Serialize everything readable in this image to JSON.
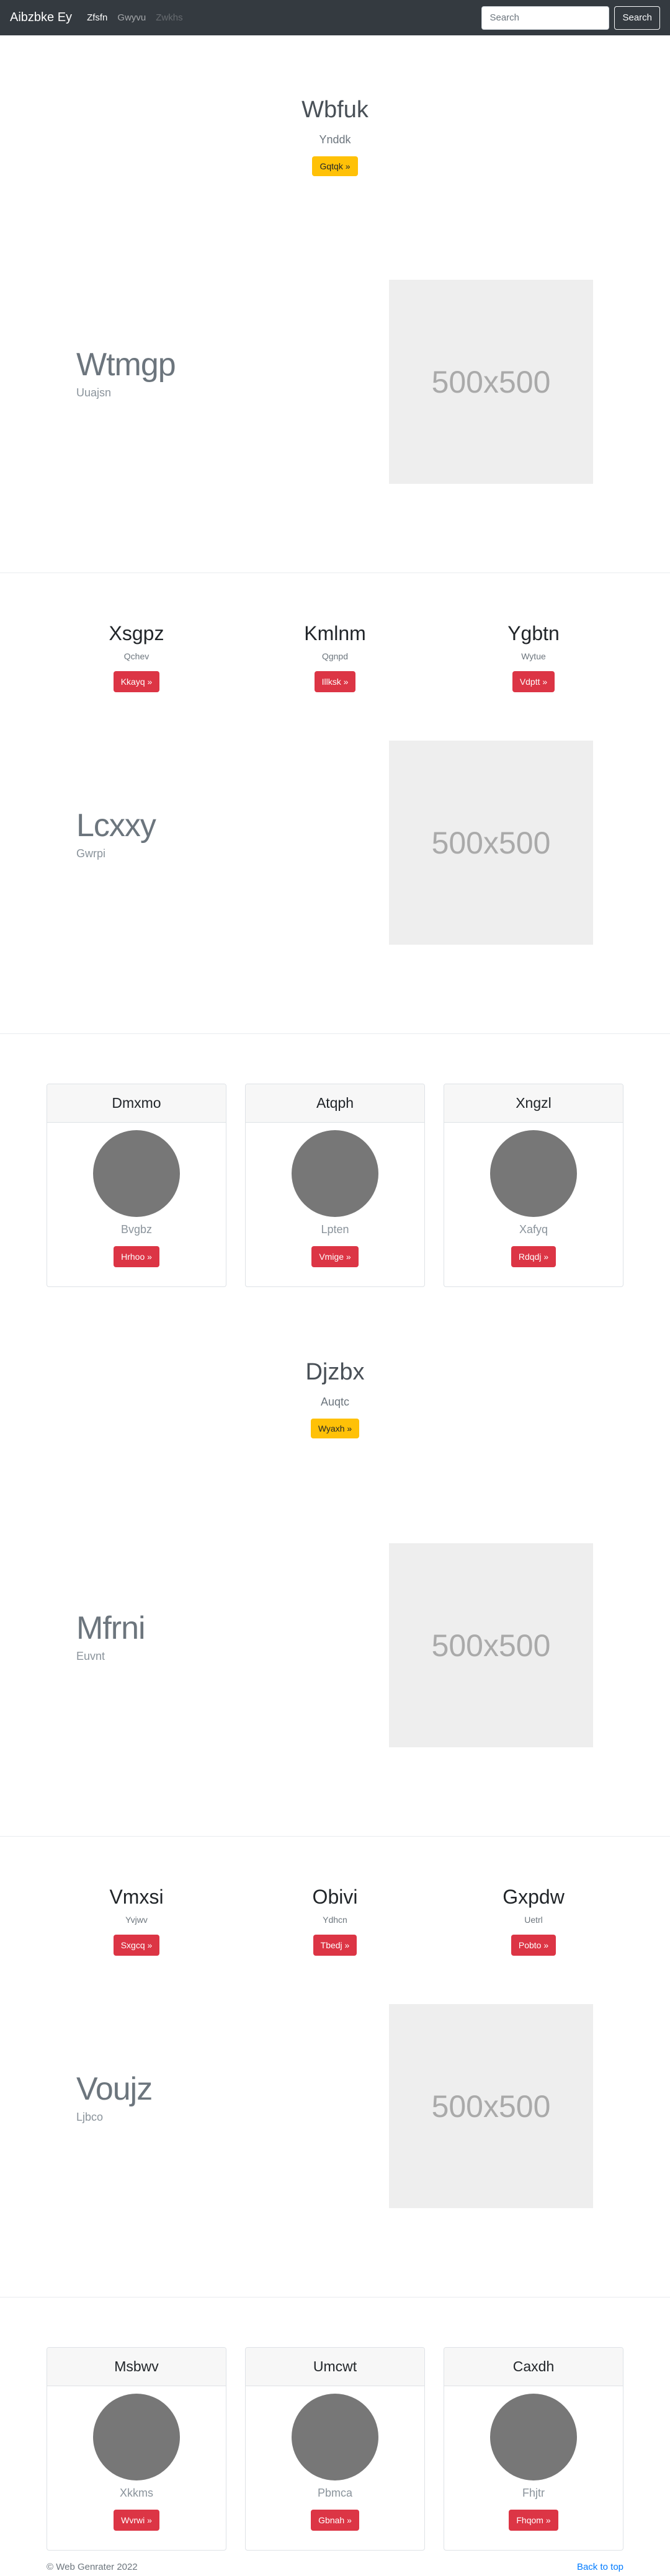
{
  "navbar": {
    "brand": "Aibzbke Ey",
    "links": [
      {
        "label": "Zfsfn",
        "state": "active"
      },
      {
        "label": "Gwyvu",
        "state": "normal"
      },
      {
        "label": "Zwkhs",
        "state": "disabled"
      }
    ],
    "search_placeholder": "Search",
    "search_button": "Search"
  },
  "sections": {
    "jumbo1": {
      "title": "Wbfuk",
      "subtitle": "Ynddk",
      "button": "Gqtqk »"
    },
    "feat1": {
      "title": "Wtmgp",
      "subtitle": "Uuajsn",
      "image_label": "500x500"
    },
    "cols1": [
      {
        "title": "Xsgpz",
        "text": "Qchev",
        "button": "Kkayq »"
      },
      {
        "title": "Kmlnm",
        "text": "Qgnpd",
        "button": "Illksk »"
      },
      {
        "title": "Ygbtn",
        "text": "Wytue",
        "button": "Vdptt »"
      }
    ],
    "feat2": {
      "title": "Lcxxy",
      "subtitle": "Gwrpi",
      "image_label": "500x500"
    },
    "cards1": [
      {
        "header": "Dmxmo",
        "text": "Bvgbz",
        "button": "Hrhoo »"
      },
      {
        "header": "Atqph",
        "text": "Lpten",
        "button": "Vmige »"
      },
      {
        "header": "Xngzl",
        "text": "Xafyq",
        "button": "Rdqdj »"
      }
    ],
    "jumbo2": {
      "title": "Djzbx",
      "subtitle": "Auqtc",
      "button": "Wyaxh »"
    },
    "feat3": {
      "title": "Mfrni",
      "subtitle": "Euvnt",
      "image_label": "500x500"
    },
    "cols2": [
      {
        "title": "Vmxsi",
        "text": "Yvjwv",
        "button": "Sxgcq »"
      },
      {
        "title": "Obivi",
        "text": "Ydhcn",
        "button": "Tbedj »"
      },
      {
        "title": "Gxpdw",
        "text": "Uetrl",
        "button": "Pobto »"
      }
    ],
    "feat4": {
      "title": "Voujz",
      "subtitle": "Ljbco",
      "image_label": "500x500"
    },
    "cards2": [
      {
        "header": "Msbwv",
        "text": "Xkkms",
        "button": "Wvrwi »"
      },
      {
        "header": "Umcwt",
        "text": "Pbmca",
        "button": "Gbnah »"
      },
      {
        "header": "Caxdh",
        "text": "Fhjtr",
        "button": "Fhqom »"
      }
    ]
  },
  "footer": {
    "copyright": "© Web Genrater 2022",
    "back_to_top": "Back to top"
  },
  "colors": {
    "navbar": "#343a40",
    "warning": "#ffc107",
    "danger": "#dc3545",
    "link": "#007bff"
  }
}
